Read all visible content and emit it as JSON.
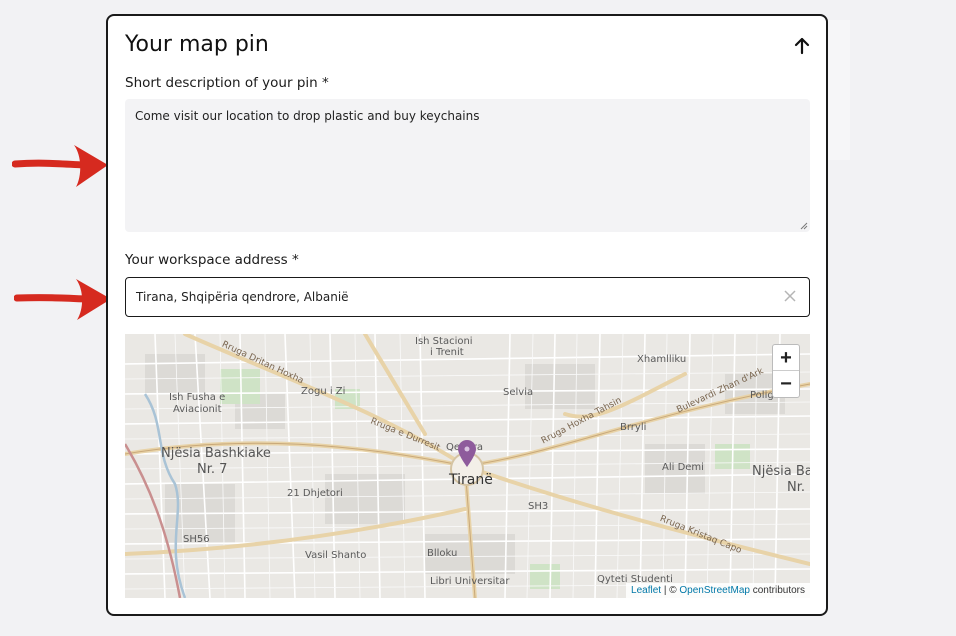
{
  "card": {
    "title": "Your map pin",
    "collapse_icon": "arrow-up-icon"
  },
  "description": {
    "label": "Short description of your pin *",
    "value": "Come visit our location to drop plastic and buy keychains"
  },
  "address": {
    "label": "Your workspace address *",
    "value": "Tirana, Shqipëria qendrore, Albanië",
    "clear_icon": "close-icon"
  },
  "map": {
    "city": "Tiranë",
    "labels": {
      "ish_stacioni": "Ish Stacioni",
      "i_trenit": "i Trenit",
      "xhamlliku": "Xhamlliku",
      "ruga_dritan_hoxha": "Rruga Dritan Hoxha",
      "zogu_i_zi": "Zogu i Zi",
      "selvia": "Selvia",
      "ish_fusha_e": "Ish Fusha e",
      "aviacionit": "Aviacionit",
      "ruga_hoxha_tahsin": "Rruga Hoxha Tahsin",
      "bulevardi_zhan_dark": "Bulevardi Zhan d'Ark",
      "poligonal": "Poligonal",
      "ruga_e_durresit": "Rruga e Durresit",
      "brryli": "Brryli",
      "qendra": "Qendra",
      "njesia_bashkiake": "Njësia Bashkiake",
      "nr7": "Nr. 7",
      "ali_demi": "Ali Demi",
      "njesia_bas": "Njësia Bas",
      "nr_short": "Nr.",
      "dhjetori": "21 Dhjetori",
      "sh3": "SH3",
      "sh56": "SH56",
      "vasil_shanto": "Vasil Shanto",
      "blloku": "Blloku",
      "ruga_kristaq_capo": "Rruga Kristaq Capo",
      "qyteti_studenti": "Qyteti Studenti",
      "libri_universitar": "Libri Universitar"
    },
    "zoom_in": "+",
    "zoom_out": "−",
    "attribution_leaflet": "Leaflet",
    "attribution_sep": " | © ",
    "attribution_osm": "OpenStreetMap",
    "attribution_tail": " contributors",
    "marker_color": "#8e5b9c"
  },
  "annotations": {
    "arrow_color": "#d62a1f"
  }
}
